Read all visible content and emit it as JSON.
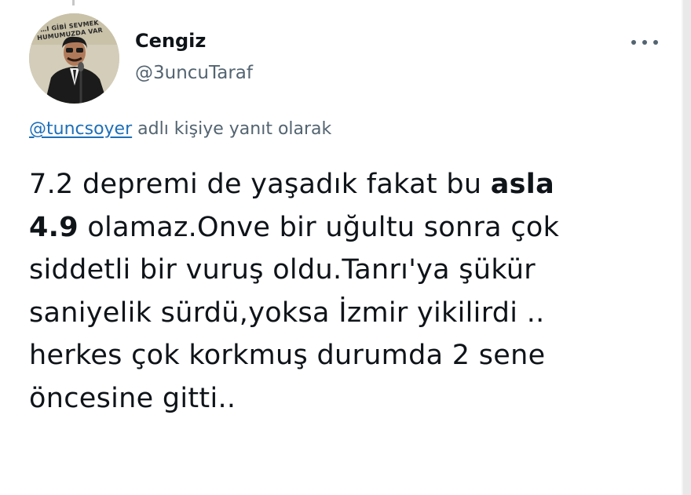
{
  "user": {
    "display_name": "Cengiz",
    "handle": "@3uncuTaraf",
    "avatar_caption_line1": "…I GİBİ SEVMEK",
    "avatar_caption_line2": "HUMUMUZDA VAR"
  },
  "reply": {
    "mention": "@tuncsoyer",
    "suffix": " adlı kişiye yanıt olarak"
  },
  "tweet": {
    "line1_a": "7.2 depremi de yaşadık fakat bu ",
    "line1_b": "asla",
    "line2_a": "4.9",
    "line2_b": " olamaz.Onve bir uğultu sonra çok",
    "line3": "siddetli bir vuruş oldu.Tanrı'ya şükür",
    "line4": "saniyelik sürdü,yoksa İzmir yikilirdi ..",
    "line5": "herkes çok korkmuş durumda 2 sene",
    "line6": "öncesine gitti.."
  },
  "icons": {
    "more": "more-horizontal-icon"
  },
  "colors": {
    "text": "#0f1419",
    "secondary": "#536471",
    "link": "#1d6fb8"
  }
}
